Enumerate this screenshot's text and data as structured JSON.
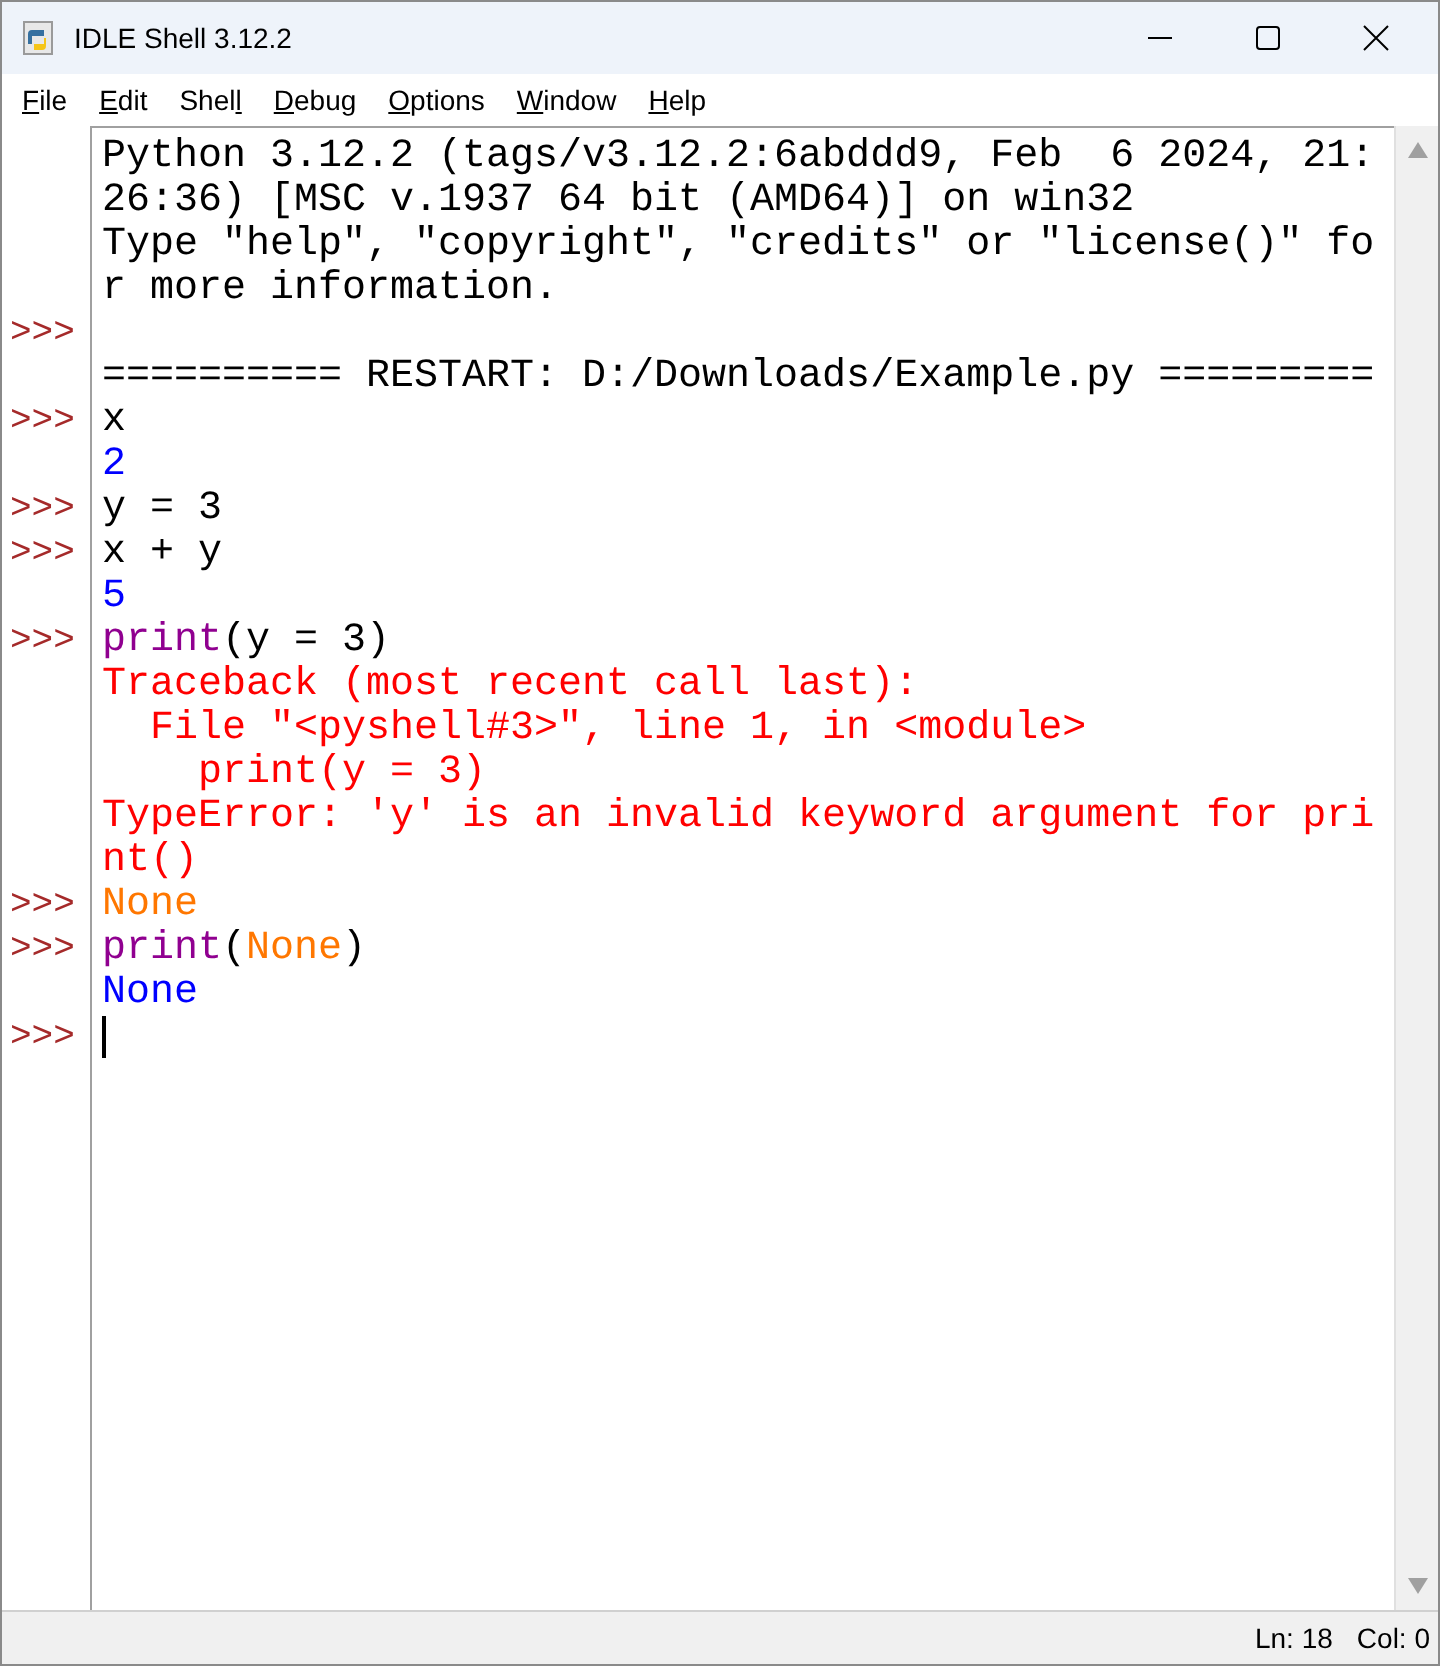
{
  "window": {
    "title": "IDLE Shell 3.12.2"
  },
  "menu": [
    {
      "key": "F",
      "post": "ile"
    },
    {
      "key": "E",
      "post": "dit"
    },
    {
      "pre": "Shel",
      "key": "l"
    },
    {
      "key": "D",
      "post": "ebug"
    },
    {
      "key": "O",
      "post": "ptions"
    },
    {
      "key": "W",
      "post": "indow"
    },
    {
      "key": "H",
      "post": "elp"
    }
  ],
  "shell": {
    "prompt": ">>>",
    "lines": [
      {
        "prompt": false,
        "cursor": false,
        "segments": [
          {
            "kind": "plain",
            "text": "Python 3.12.2 (tags/v3.12.2:6abddd9, Feb  6 2024, 21:"
          }
        ]
      },
      {
        "prompt": false,
        "cursor": false,
        "segments": [
          {
            "kind": "plain",
            "text": "26:36) [MSC v.1937 64 bit (AMD64)] on win32"
          }
        ]
      },
      {
        "prompt": false,
        "cursor": false,
        "segments": [
          {
            "kind": "plain",
            "text": "Type \"help\", \"copyright\", \"credits\" or \"license()\" fo"
          }
        ]
      },
      {
        "prompt": false,
        "cursor": false,
        "segments": [
          {
            "kind": "plain",
            "text": "r more information."
          }
        ]
      },
      {
        "prompt": true,
        "cursor": false
      },
      {
        "prompt": false,
        "cursor": false,
        "segments": [
          {
            "kind": "plain",
            "text": "========== RESTART: D:/Downloads/Example.py ========="
          }
        ]
      },
      {
        "prompt": true,
        "cursor": false,
        "segments": [
          {
            "kind": "plain",
            "text": "x"
          }
        ]
      },
      {
        "prompt": false,
        "cursor": false,
        "segments": [
          {
            "kind": "output",
            "text": "2"
          }
        ]
      },
      {
        "prompt": true,
        "cursor": false,
        "segments": [
          {
            "kind": "plain",
            "text": "y = 3"
          }
        ]
      },
      {
        "prompt": true,
        "cursor": false,
        "segments": [
          {
            "kind": "plain",
            "text": "x + y"
          }
        ]
      },
      {
        "prompt": false,
        "cursor": false,
        "segments": [
          {
            "kind": "output",
            "text": "5"
          }
        ]
      },
      {
        "prompt": true,
        "cursor": false,
        "segments": [
          {
            "kind": "builtin",
            "text": "print"
          },
          {
            "kind": "plain",
            "text": "(y = 3)"
          }
        ]
      },
      {
        "prompt": false,
        "cursor": false,
        "segments": [
          {
            "kind": "error",
            "text": "Traceback (most recent call last):"
          }
        ]
      },
      {
        "prompt": false,
        "cursor": false,
        "segments": [
          {
            "kind": "error",
            "text": "  File \"<pyshell#3>\", line 1, in <module>"
          }
        ]
      },
      {
        "prompt": false,
        "cursor": false,
        "segments": [
          {
            "kind": "error",
            "text": "    print(y = 3)"
          }
        ]
      },
      {
        "prompt": false,
        "cursor": false,
        "segments": [
          {
            "kind": "error",
            "text": "TypeError: 'y' is an invalid keyword argument for pri"
          }
        ]
      },
      {
        "prompt": false,
        "cursor": false,
        "segments": [
          {
            "kind": "error",
            "text": "nt()"
          }
        ]
      },
      {
        "prompt": true,
        "cursor": false,
        "segments": [
          {
            "kind": "keyword",
            "text": "None"
          }
        ]
      },
      {
        "prompt": true,
        "cursor": false,
        "segments": [
          {
            "kind": "builtin",
            "text": "print"
          },
          {
            "kind": "plain",
            "text": "("
          },
          {
            "kind": "keyword",
            "text": "None"
          },
          {
            "kind": "plain",
            "text": ")"
          }
        ]
      },
      {
        "prompt": false,
        "cursor": false,
        "segments": [
          {
            "kind": "output",
            "text": "None"
          }
        ]
      },
      {
        "prompt": true,
        "cursor": true
      }
    ]
  },
  "status_bar": {
    "line": "Ln: 18",
    "column": "Col: 0"
  }
}
